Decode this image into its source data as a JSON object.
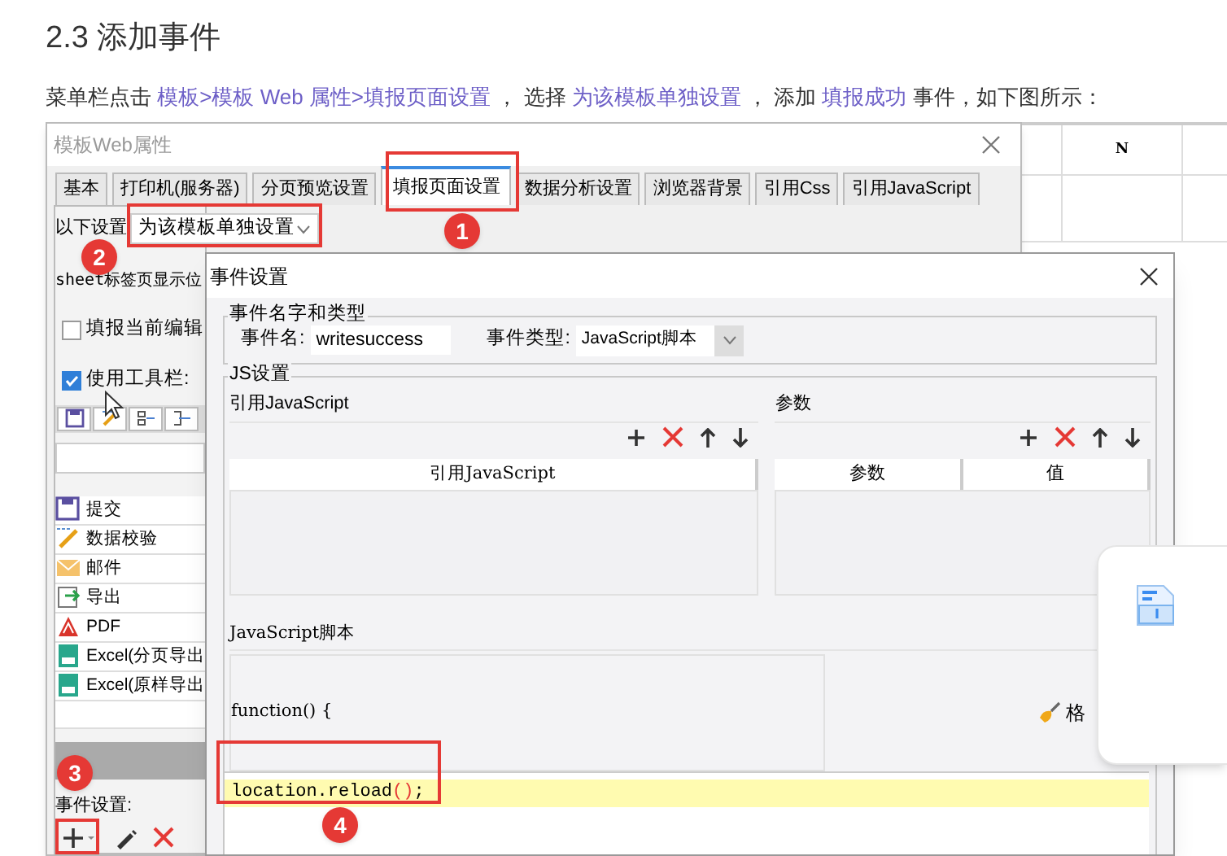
{
  "heading": "2.3 添加事件",
  "intro": [
    {
      "text": "菜单栏点击 ",
      "link": false
    },
    {
      "text": "模板>模板 Web 属性>填报页面设置",
      "link": true
    },
    {
      "text": " ， 选择 ",
      "link": false
    },
    {
      "text": "为该模板单独设置",
      "link": true
    },
    {
      "text": " ， 添加 ",
      "link": false
    },
    {
      "text": "填报成功",
      "link": true
    },
    {
      "text": " 事件，如下图所示：",
      "link": false
    }
  ],
  "sheet": {
    "column_header": "N"
  },
  "outer_window": {
    "title": "模板Web属性",
    "tabs": [
      {
        "label": "基本",
        "selected": false
      },
      {
        "label": "打印机(服务器)",
        "selected": false
      },
      {
        "label": "分页预览设置",
        "selected": false
      },
      {
        "label": "填报页面设置",
        "selected": true
      },
      {
        "label": "数据分析设置",
        "selected": false
      },
      {
        "label": "浏览器背景",
        "selected": false
      },
      {
        "label": "引用Css",
        "selected": false
      },
      {
        "label": "引用JavaScript",
        "selected": false
      }
    ],
    "setting_label": "以下设置",
    "setting_value": "为该模板单独设置",
    "sheet_label": "sheet标签页显示位",
    "options": [
      {
        "label": "填报当前编辑",
        "checked": false
      },
      {
        "label": "使用工具栏:",
        "checked": true
      }
    ],
    "toolbar_items": [
      {
        "kind": "save",
        "label": "提交"
      },
      {
        "kind": "check",
        "label": "数据校验"
      },
      {
        "kind": "mail",
        "label": "邮件"
      },
      {
        "kind": "export",
        "label": "导出"
      },
      {
        "kind": "pdf",
        "label": "PDF"
      },
      {
        "kind": "excel",
        "label": "Excel(分页导出"
      },
      {
        "kind": "excel",
        "label": "Excel(原样导出"
      }
    ],
    "event_label": "事件设置:"
  },
  "dialog": {
    "title": "事件设置",
    "name_group": "事件名字和类型",
    "name_label": "事件名:",
    "name_value": "writesuccess",
    "type_label": "事件类型:",
    "type_value": "JavaScript脚本",
    "js_group": "JS设置",
    "ref_title": "引用JavaScript",
    "ref_column": "引用JavaScript",
    "param_title": "参数",
    "param_columns": [
      "参数",
      "值"
    ],
    "script_title": "JavaScript脚本",
    "function_line": "function() {",
    "format_button": "格",
    "code_line": {
      "before": "location.reload",
      "brackets": "()",
      "after": ";"
    }
  },
  "annotations": [
    "1",
    "2",
    "3",
    "4"
  ]
}
